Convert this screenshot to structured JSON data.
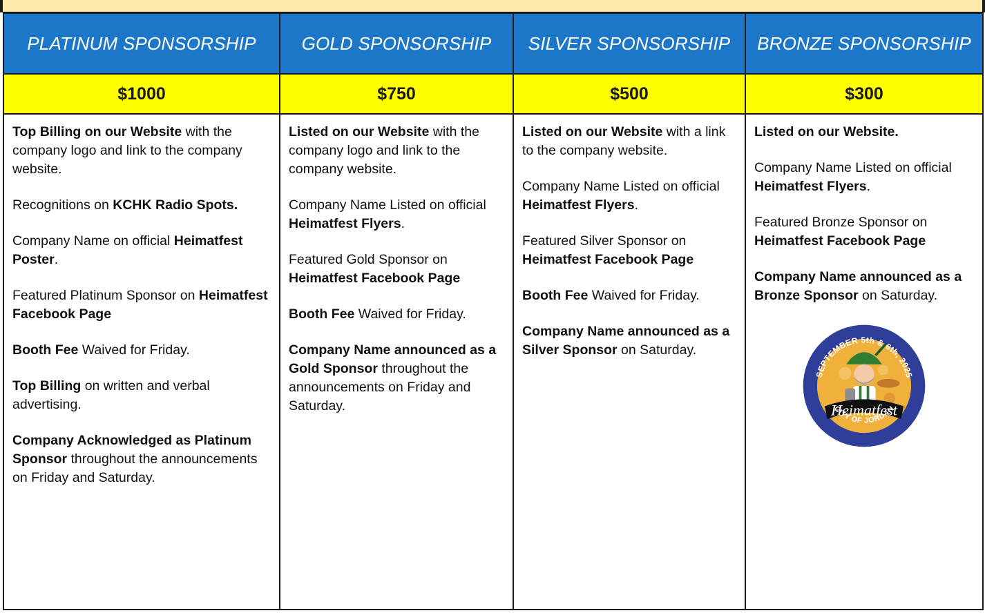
{
  "tiers": [
    {
      "title": "PLATINUM SPONSORSHIP",
      "price": "$1000",
      "items": [
        [
          {
            "b": "Top Billing on our Website"
          },
          {
            "t": " with the company logo and link to the company website."
          }
        ],
        [
          {
            "t": "Recognitions on "
          },
          {
            "b": "KCHK Radio Spots."
          }
        ],
        [
          {
            "t": "Company Name on official "
          },
          {
            "b": "Heimatfest Poster"
          },
          {
            "t": "."
          }
        ],
        [
          {
            "t": "Featured Platinum Sponsor on "
          },
          {
            "b": "Heimatfest Facebook Page"
          }
        ],
        [
          {
            "b": "Booth Fee"
          },
          {
            "t": " Waived for Friday."
          }
        ],
        [
          {
            "b": "Top Billing"
          },
          {
            "t": " on written and verbal advertising."
          }
        ],
        [
          {
            "b": "Company Acknowledged as Platinum Sponsor"
          },
          {
            "t": " throughout the announcements on Friday and Saturday."
          }
        ]
      ]
    },
    {
      "title": "GOLD SPONSORSHIP",
      "price": "$750",
      "items": [
        [
          {
            "b": "Listed on our Website"
          },
          {
            "t": " with the company logo and link to the company website."
          }
        ],
        [
          {
            "t": "Company Name Listed on official "
          },
          {
            "b": "Heimatfest Flyers"
          },
          {
            "t": "."
          }
        ],
        [
          {
            "t": "Featured Gold Sponsor on "
          },
          {
            "b": "Heimatfest Facebook Page"
          }
        ],
        [
          {
            "b": "Booth Fee"
          },
          {
            "t": " Waived for Friday."
          }
        ],
        [
          {
            "b": "Company Name announced as a Gold Sponsor"
          },
          {
            "t": " throughout the announcements on Friday and Saturday."
          }
        ]
      ]
    },
    {
      "title": "SILVER SPONSORSHIP",
      "price": "$500",
      "items": [
        [
          {
            "b": "Listed on our Website"
          },
          {
            "t": " with a link to the company website."
          }
        ],
        [
          {
            "t": "Company Name Listed on official "
          },
          {
            "b": "Heimatfest Flyers"
          },
          {
            "t": "."
          }
        ],
        [
          {
            "t": "Featured Silver Sponsor on "
          },
          {
            "b": "Heimatfest Facebook Page"
          }
        ],
        [
          {
            "b": "Booth Fee"
          },
          {
            "t": " Waived for Friday."
          }
        ],
        [
          {
            "b": "Company Name announced as a Silver Sponsor"
          },
          {
            "t": " on Saturday."
          }
        ]
      ]
    },
    {
      "title": "BRONZE SPONSORSHIP",
      "price": "$300",
      "items": [
        [
          {
            "b": "Listed on our Website."
          }
        ],
        [
          {
            "t": "Company Name Listed on official "
          },
          {
            "b": "Heimatfest Flyers"
          },
          {
            "t": "."
          }
        ],
        [
          {
            "t": "Featured Bronze Sponsor on "
          },
          {
            "b": "Heimatfest Facebook Page"
          }
        ],
        [
          {
            "b": "Company Name announced as a Bronze Sponsor"
          },
          {
            "t": " on Saturday."
          }
        ]
      ]
    }
  ],
  "logo": {
    "top_text": "SEPTEMBER 5th & 6th, 2025",
    "banner_text": "Heimatfest",
    "bottom_text": "CITY OF JORDAN"
  },
  "colors": {
    "header_blue": "#1d77c9",
    "price_yellow": "#ffff00",
    "top_band": "#fde9a9",
    "logo_ring": "#2f3f99",
    "logo_fill": "#f0b03c"
  }
}
